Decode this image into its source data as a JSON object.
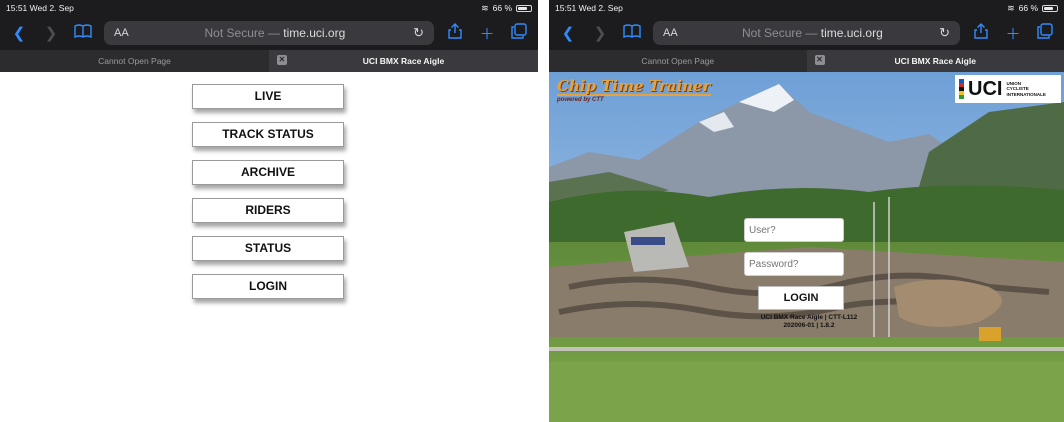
{
  "status_bar": {
    "time_date": "15:51  Wed 2. Sep",
    "battery": "66 %"
  },
  "browser": {
    "address_aa": "AA",
    "address_prefix": "Not Secure —",
    "address_domain": "time.uci.org",
    "tabs": [
      {
        "label": "Cannot Open Page"
      },
      {
        "label": "UCI BMX Race Aigle"
      }
    ]
  },
  "icons": {
    "back": "chevron-left-icon",
    "forward": "chevron-right-icon",
    "bookmarks": "book-icon",
    "reload": "reload-icon",
    "share": "share-icon",
    "new_tab": "plus-icon",
    "tabs_overview": "tabs-icon",
    "close_tab": "close-icon"
  },
  "menu": {
    "items": [
      {
        "label": "LIVE"
      },
      {
        "label": "TRACK STATUS"
      },
      {
        "label": "ARCHIVE"
      },
      {
        "label": "RIDERS"
      },
      {
        "label": "STATUS"
      },
      {
        "label": "LOGIN"
      }
    ]
  },
  "login_page": {
    "brand_title": "Chip Time Trainer",
    "brand_sub": "powered by CTT",
    "uci_mark": "UCI",
    "uci_sub_line1": "UNION",
    "uci_sub_line2": "CYCLISTE",
    "uci_sub_line3": "INTERNATIONALE",
    "user_placeholder": "User?",
    "password_placeholder": "Password?",
    "login_label": "LOGIN",
    "footer_line1": "UCI BMX Race Aigle | CTT-L112",
    "footer_line2": "202006-01 | 1.8.2"
  },
  "colors": {
    "accent": "#2f8cff",
    "chrome": "#1c1c1e",
    "brand_orange": "#e8a23a"
  }
}
